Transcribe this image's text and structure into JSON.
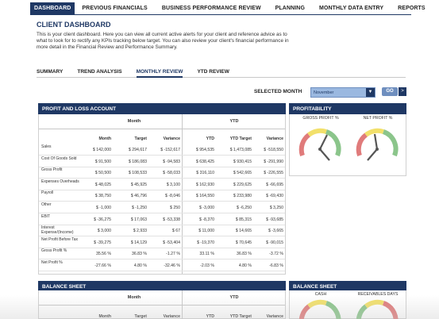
{
  "topnav": {
    "items": [
      "DASHBOARD",
      "PREVIOUS FINANCIALS",
      "BUSINESS PERFORMANCE REVIEW",
      "PLANNING",
      "MONTHLY DATA ENTRY",
      "REPORTS"
    ],
    "active": "DASHBOARD"
  },
  "page": {
    "title": "CLIENT DASHBOARD",
    "intro": "This is your client dashboard. Here you can view all current active alerts for your client and reference advice as to what to look for to rectify any KPIs tracking below target. You can also review your client's financial performance in more detail in the Financial Review and Performance Summary."
  },
  "subtabs": [
    "SUMMARY",
    "TREND ANALYSIS",
    "MONTHLY REVIEW",
    "YTD REVIEW"
  ],
  "month_selector": {
    "label": "SELECTED MONTH",
    "value": "November",
    "go_label": "GO",
    "arrow": ">"
  },
  "pl": {
    "title": "PROFIT AND LOSS ACCOUNT",
    "group_month": "Month",
    "group_ytd": "YTD",
    "columns": [
      "Month",
      "Target",
      "Variance",
      "YTD",
      "YTD Target",
      "Variance"
    ],
    "rows": [
      {
        "label": "Sales",
        "values": [
          "$ 142,000",
          "$ 294,617",
          "$ -152,617",
          "$ 954,535",
          "$ 1,473,085",
          "$ -518,550"
        ]
      },
      {
        "label": "Cost Of Goods Sold",
        "values": [
          "$ 91,500",
          "$ 186,083",
          "$ -94,583",
          "$ 638,425",
          "$ 930,415",
          "$ -291,990"
        ]
      },
      {
        "label": "Gross Profit",
        "values": [
          "$ 50,500",
          "$ 108,533",
          "$ -58,033",
          "$ 316,110",
          "$ 542,665",
          "$ -226,555"
        ]
      },
      {
        "label": "Expenses Overheads",
        "values": [
          "$ 48,025",
          "$ 45,925",
          "$ 3,100",
          "$ 162,930",
          "$ 229,625",
          "$ -66,695"
        ]
      },
      {
        "label": "Payroll",
        "values": [
          "$ 38,750",
          "$ 46,796",
          "$ -8,046",
          "$ 164,550",
          "$ 233,980",
          "$ -69,430"
        ]
      },
      {
        "label": "Other",
        "values": [
          "$ -1,000",
          "$ -1,250",
          "$ 250",
          "$ -3,000",
          "$ -6,250",
          "$ 3,250"
        ]
      },
      {
        "label": "EBIT",
        "values": [
          "$ -36,275",
          "$ 17,063",
          "$ -53,338",
          "$ -8,370",
          "$ 85,315",
          "$ -93,685"
        ]
      },
      {
        "label": "Interest Expense/(Income)",
        "values": [
          "$ 3,000",
          "$ 2,933",
          "$ 67",
          "$ 11,000",
          "$ 14,665",
          "$ -3,665"
        ]
      },
      {
        "label": "Net Profit Before Tax",
        "values": [
          "$ -39,275",
          "$ 14,129",
          "$ -53,404",
          "$ -19,370",
          "$ 70,645",
          "$ -90,015"
        ]
      },
      {
        "label": "Gross Profit %",
        "values": [
          "35.56 %",
          "36.83 %",
          "-1.27 %",
          "33.11 %",
          "36.83 %",
          "-3.72 %"
        ]
      },
      {
        "label": "Net Profit %",
        "values": [
          "-27.66 %",
          "4.80 %",
          "-32.46 %",
          "-2.03 %",
          "4.80 %",
          "-6.83 %"
        ]
      }
    ]
  },
  "profitability": {
    "title": "PROFITABILITY",
    "gauges": [
      {
        "label": "GROSS PROFIT %",
        "value": 35.56,
        "target": 36.83
      },
      {
        "label": "NET PROFIT %",
        "value": -27.66,
        "target": 4.8
      }
    ]
  },
  "balance_sheet": {
    "title": "BALANCE SHEET",
    "group_month": "Month",
    "group_ytd": "YTD",
    "columns": [
      "Month",
      "Target",
      "Variance",
      "YTD",
      "YTD Target",
      "Variance"
    ]
  },
  "balance_sheet_gauges": {
    "title": "BALANCE SHEET",
    "gauges": [
      {
        "label": "CASH"
      },
      {
        "label": "RECEIVABLES DAYS"
      }
    ]
  },
  "colors": {
    "navy": "#1f3864",
    "gauge_red": "#e07b7b",
    "gauge_yellow": "#f2e06b",
    "gauge_green": "#8bc58b"
  }
}
